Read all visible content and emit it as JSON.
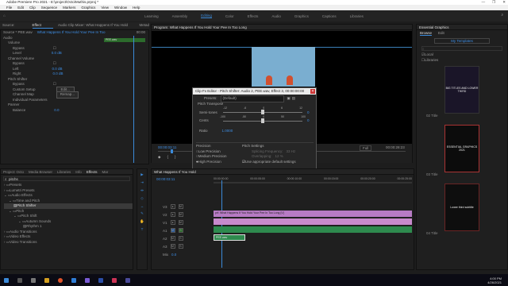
{
  "title": "Adobe Premiere Pro 2021 - E:\\project\\Octo\\Muthis.prproj *",
  "window_buttons": [
    "—",
    "❐",
    "✕"
  ],
  "menu": [
    "File",
    "Edit",
    "Clip",
    "Sequence",
    "Markers",
    "Graphics",
    "View",
    "Window",
    "Help"
  ],
  "workspaces": [
    "Learning",
    "Assembly",
    "Editing",
    "Color",
    "Effects",
    "Audio",
    "Graphics",
    "Captions",
    "Libraries"
  ],
  "active_workspace": "Editing",
  "left_panel": {
    "tabs": [
      "Source: PEE.wav",
      "Effect Controls",
      "Audio Clip Mixer: What Happens If You Hold Your Fee",
      "Metad"
    ],
    "subtitle": "Source * PEE.wav",
    "clip_name": "What Happens If You Hold Your Pee In Too",
    "time": "00:00",
    "clip_label": "PEE.wav",
    "rows": [
      {
        "label": "Audio",
        "val": ""
      },
      {
        "label": "Volume",
        "val": ""
      },
      {
        "label": "Bypass",
        "val": ""
      },
      {
        "label": "Level",
        "val": "0.0 dB"
      },
      {
        "label": "Channel Volume",
        "val": ""
      },
      {
        "label": "Bypass",
        "val": ""
      },
      {
        "label": "Left",
        "val": "0.0 dB"
      },
      {
        "label": "Right",
        "val": "0.0 dB"
      },
      {
        "label": "Pitch Shifter",
        "val": ""
      },
      {
        "label": "Bypass",
        "val": ""
      },
      {
        "label": "Custom Setup",
        "val": "Edit..."
      },
      {
        "label": "Channel Map",
        "val": "Remap..."
      },
      {
        "label": "Individual Parameters",
        "val": ""
      },
      {
        "label": "Panner",
        "val": ""
      },
      {
        "label": "Balance",
        "val": "0.0"
      }
    ]
  },
  "program": {
    "title": "Program: What Happens If You Hold Your Pee In Too Long",
    "timecode": "00:00:03:11",
    "fit": "Full",
    "duration": "00:00:28:23",
    "fit_label": "Fit"
  },
  "dialog": {
    "title": "Clip Fx Editor - Pitch Shifter: Audio 2, PEE.wav, Effect 3, 00:00:00:00",
    "presets_label": "Presets:",
    "preset": "(Default)",
    "section": "Pitch Transpose",
    "semitones_label": "Semi-tones",
    "semitones_ticks": [
      "-12",
      "-6",
      "0",
      "6",
      "12"
    ],
    "semitones_val": "0",
    "cents_label": "Cents",
    "cents_ticks": [
      "-100",
      "-50",
      "0",
      "50",
      "100"
    ],
    "cents_val": "0",
    "ratio_label": "Ratio",
    "ratio_val": "1.0000",
    "precision_label": "Precision",
    "precision_options": [
      "Low Precision",
      "Medium Precision",
      "High Precision"
    ],
    "precision_selected": "High Precision",
    "pitch_settings_label": "Pitch Settings",
    "splicing_label": "Splicing Frequency:",
    "splicing_val": "33 Hz",
    "overlapping_label": "Overlapping:",
    "overlapping_val": "12 %",
    "appropriate_label": "Use appropriate default settings"
  },
  "essential": {
    "title": "Essential Graphics",
    "tabs": [
      "Browse",
      "Edit"
    ],
    "my_templates": "My Templates",
    "local": "Local",
    "libraries": "Libraries",
    "cards": [
      {
        "text": "BIG TITLES AND LOWER THIRD",
        "label": "02 Title"
      },
      {
        "text": "ESSENTIAL GRAPHICS 2021",
        "label": "03 Title"
      },
      {
        "text": "Lower third subtitle",
        "label": "04 Title"
      }
    ]
  },
  "project": {
    "tabs": [
      "Project: Octo",
      "Media Browser",
      "Libraries",
      "Info",
      "Effects",
      "Mar"
    ],
    "search": "pitchs",
    "tree": [
      "Presets",
      "Lumetri Presets",
      "Audio Effects",
      "Time and Pitch",
      "Pitch Shifter",
      "Pitch",
      "Pitch Shift",
      "Autumn Sounds",
      "Rhythm 1",
      "Audio Transitions",
      "Video Effects",
      "Video Transitions"
    ]
  },
  "timeline": {
    "title": "What Happens If You Hold",
    "timecode": "00:00:03:11",
    "ruler": [
      "00:00:00:00",
      "00:00:05:00",
      "00:00:10:00",
      "00:00:15:00",
      "00:00:20:00",
      "00:00:25:00"
    ],
    "tracks_video": [
      "V3",
      "V2",
      "V1"
    ],
    "tracks_audio": [
      "A1",
      "A2",
      "A3"
    ],
    "master": "Mix",
    "master_val": "0.0",
    "clip_labels": [
      "prf: What Happens If You Hold Your Pee In Too Long [V]",
      "PEE.wav"
    ]
  },
  "taskbar": {
    "time": "4:00 PM",
    "date": "4/26/2021"
  }
}
